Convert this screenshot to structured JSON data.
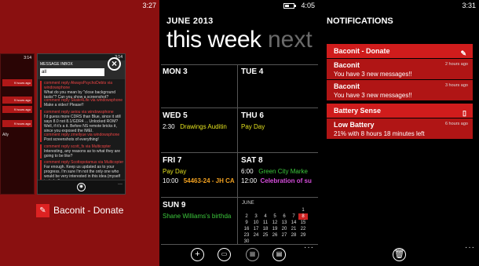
{
  "panel1": {
    "clock": "3:27",
    "mini_clock": "3:14",
    "mini_rows": [
      "9 hours ago",
      "9 hours ago",
      "9 hours ago",
      "9 hours ago"
    ],
    "mini_text": "Ally",
    "inbox": {
      "clock": "3:14",
      "title": "MESSAGE INBOX",
      "filter_value": "all",
      "messages": [
        {
          "from": "comment reply  AlwaysPsychoDebts via windowsphone",
          "body": "What do you mean by \"close background tasks\"? Can you show a screenshot?"
        },
        {
          "from": "comment reply  Skate4Life via windowsphone",
          "body": "Make a video! Please!!"
        },
        {
          "from": "comment reply  aeiou via windowsphone",
          "body": "I'd guess more CDRS than Blue, since it still says 8.0 not 8.1/GDR4 ... Unlocked ROM? Well, if it's a it. Before NS remote bricks it, since you exposed the IMEI."
        },
        {
          "from": "comment reply  zmellyue via windowsphone",
          "body": "Post screenshots of everything!"
        },
        {
          "from": "comment reply  scott_fs via Multicopter",
          "body": "Interesting, any reasons as to what they are going to be like?"
        },
        {
          "from": "comment reply  Scottopotamus via Multicopter",
          "body": "Far enough. Keep us updated as to your progress. I'm sure I'm not the only one who would be very interested in this idea (myself included)."
        }
      ]
    },
    "app_label": "Baconit - Donate"
  },
  "panel2": {
    "clock": "4:05",
    "month": "JUNE 2013",
    "pivot_current": "this week",
    "pivot_next": "next",
    "days": [
      {
        "label": "MON 3",
        "events": []
      },
      {
        "label": "TUE 4",
        "events": []
      },
      {
        "label": "WED 5",
        "events": [
          {
            "time": "2:30",
            "title": "Drawings Auditin"
          }
        ]
      },
      {
        "label": "THU 6",
        "events": [
          {
            "time": "",
            "title": "Pay Day"
          }
        ]
      },
      {
        "label": "FRI 7",
        "events": [
          {
            "time": "",
            "title": "Pay Day"
          },
          {
            "time": "10:00",
            "title": "54463-24 - JH CA"
          }
        ]
      },
      {
        "label": "SAT 8",
        "events": [
          {
            "time": "6:00",
            "title": "Green City Marke"
          },
          {
            "time": "12:00",
            "title": "Celebration of su"
          }
        ]
      },
      {
        "label": "SUN 9",
        "events": [
          {
            "time": "",
            "title": "Shane Williams's birthda"
          }
        ]
      }
    ],
    "mini_cal": {
      "month": "JUNE",
      "weeks": [
        [
          "",
          "",
          "",
          "",
          "",
          "",
          "1"
        ],
        [
          "2",
          "3",
          "4",
          "5",
          "6",
          "7",
          "8"
        ],
        [
          "9",
          "10",
          "11",
          "12",
          "13",
          "14",
          "15"
        ],
        [
          "16",
          "17",
          "18",
          "19",
          "20",
          "21",
          "22"
        ],
        [
          "23",
          "24",
          "25",
          "26",
          "27",
          "28",
          "29"
        ],
        [
          "30",
          "",
          "",
          "",
          "",
          "",
          ""
        ]
      ],
      "highlighted": "8"
    },
    "event_colors": {
      "yellow": "#e3e11e",
      "green": "#3cc83c",
      "magenta": "#d64ddc",
      "orange": "#f0a020"
    }
  },
  "panel3": {
    "clock": "3:31",
    "title": "NOTIFICATIONS",
    "groups": [
      {
        "app": "Baconit - Donate",
        "items": [
          {
            "title": "Baconit",
            "body": "You have 3 new messages!!",
            "time": "2 hours ago"
          },
          {
            "title": "Baconit",
            "body": "You have 3 new messages!!",
            "time": "3 hours ago"
          }
        ]
      },
      {
        "app": "Battery Sense",
        "items": [
          {
            "title": "Low Battery",
            "body": "21% with 8 hours 18 minutes left",
            "time": "6 hours ago"
          }
        ]
      }
    ],
    "colors": {
      "header": "#d01c1c",
      "item": "#b01515"
    }
  }
}
